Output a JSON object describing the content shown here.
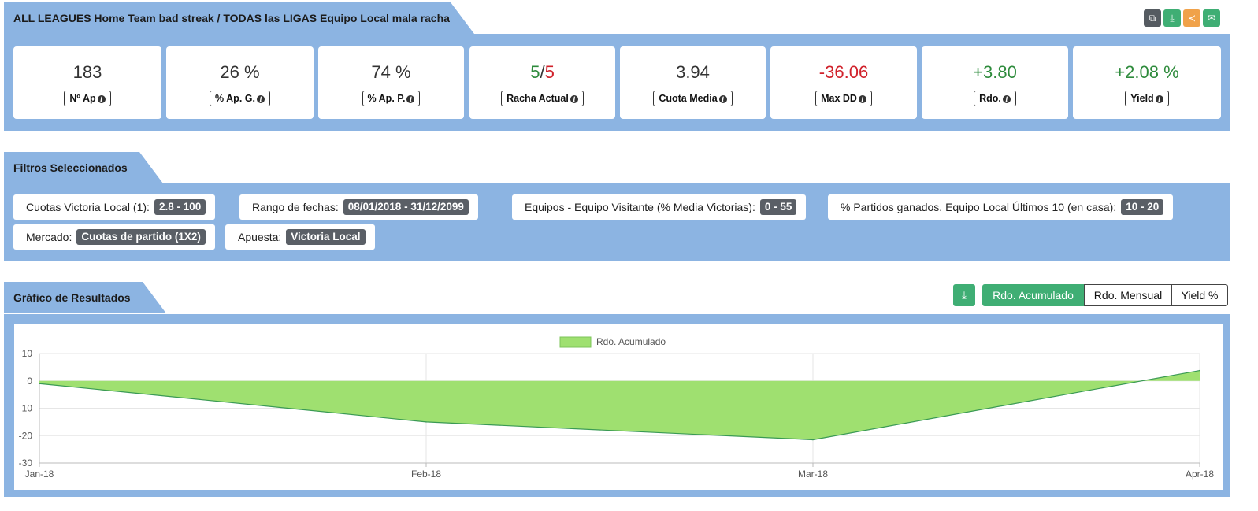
{
  "header": {
    "title": "ALL LEAGUES Home Team bad streak / TODAS las LIGAS Equipo Local mala racha",
    "actions": [
      {
        "icon": "copy-icon",
        "glyph": "⧉",
        "color": "#555b61"
      },
      {
        "icon": "download-icon",
        "glyph": "⤓",
        "color": "#3fae74"
      },
      {
        "icon": "share-icon",
        "glyph": "≺",
        "color": "#f0a24a"
      },
      {
        "icon": "email-icon",
        "glyph": "✉",
        "color": "#3fae74"
      }
    ]
  },
  "stats": [
    {
      "value": "183",
      "label": "Nº Ap"
    },
    {
      "value": "26 %",
      "label": "% Ap. G."
    },
    {
      "value": "74 %",
      "label": "% Ap. P."
    },
    {
      "value_a": "5",
      "sep": "/",
      "value_b": "5",
      "label": "Racha Actual"
    },
    {
      "value": "3.94",
      "label": "Cuota Media"
    },
    {
      "value": "-36.06",
      "label": "Max DD"
    },
    {
      "value": "+3.80",
      "label": "Rdo."
    },
    {
      "value": "+2.08 %",
      "label": "Yield"
    }
  ],
  "colors": {
    "positive": "#2e8b3c",
    "negative": "#d0202a",
    "band": "#8cb4e2",
    "accent": "#3fae74",
    "area": "#9fe070",
    "line": "#3a9a54"
  },
  "filters": {
    "title": "Filtros Seleccionados",
    "items": [
      {
        "label": "Cuotas Victoria Local (1):",
        "value": "2.8 - 100"
      },
      {
        "label": "Rango de fechas:",
        "value": "08/01/2018 - 31/12/2099"
      },
      {
        "label": "Equipos - Equipo Visitante (% Media Victorias):",
        "value": "0 - 55"
      },
      {
        "label": "% Partidos ganados. Equipo Local Últimos 10 (en casa):",
        "value": "10 - 20"
      },
      {
        "label": "Mercado:",
        "value": "Cuotas de partido (1X2)"
      },
      {
        "label": "Apuesta:",
        "value": "Victoria Local"
      }
    ]
  },
  "results": {
    "title": "Gráfico de Resultados",
    "download_icon": "download-icon",
    "tabs": [
      "Rdo. Acumulado",
      "Rdo. Mensual",
      "Yield %"
    ],
    "active_tab": "Rdo. Acumulado"
  },
  "chart_data": {
    "type": "area",
    "x": [
      "Jan-18",
      "Feb-18",
      "Mar-18",
      "Apr-18"
    ],
    "series": [
      {
        "name": "Rdo. Acumulado",
        "values": [
          -1,
          -15,
          -21.5,
          3.8
        ]
      }
    ],
    "yticks": [
      10,
      0,
      -10,
      -20,
      -30
    ],
    "ylim": [
      -30,
      10
    ],
    "grid": true,
    "legend": "top-center"
  }
}
